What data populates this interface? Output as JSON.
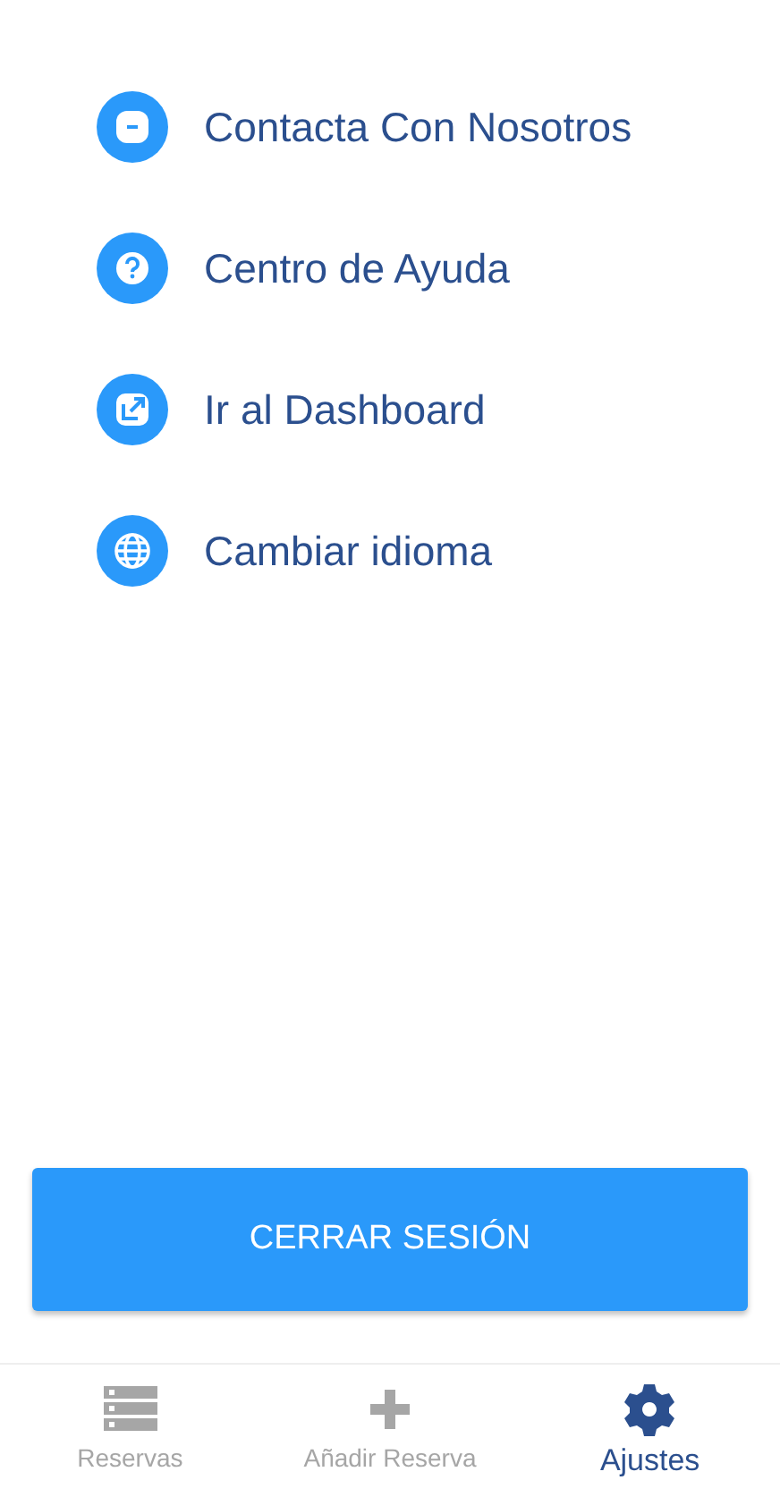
{
  "menu": [
    {
      "kind": "chat",
      "label": "Contacta Con Nosotros"
    },
    {
      "kind": "help",
      "label": "Centro de Ayuda"
    },
    {
      "kind": "external",
      "label": "Ir al Dashboard"
    },
    {
      "kind": "globe",
      "label": "Cambiar idioma"
    }
  ],
  "logout_button": "CERRAR SESIÓN",
  "tabs": [
    {
      "kind": "list",
      "label": "Reservas",
      "selected": false
    },
    {
      "kind": "add",
      "label": "Añadir Reserva",
      "selected": false
    },
    {
      "kind": "settings",
      "label": "Ajustes",
      "selected": true
    }
  ]
}
